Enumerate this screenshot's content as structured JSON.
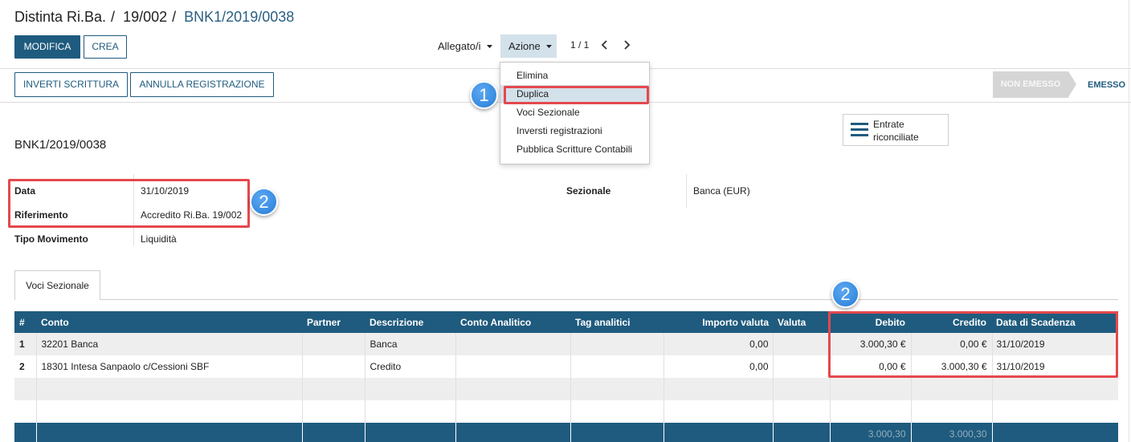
{
  "colors": {
    "primary": "#1f5b7e",
    "link": "#2a5f82",
    "highlight_red": "#e5484d",
    "badge_blue": "#3b8fe4",
    "row_alt": "#eeeeee",
    "menu_hover": "#d3e1ea",
    "status_inactive": "#d5d5d5"
  },
  "breadcrumb": {
    "items": [
      "Distinta Ri.Ba.",
      "19/002",
      "BNK1/2019/0038"
    ],
    "separator": "/"
  },
  "buttons": {
    "edit": "MODIFICA",
    "create": "CREA"
  },
  "toolbar": {
    "attachments": "Allegato/i",
    "action": "Azione",
    "pager": "1 / 1"
  },
  "action_menu": {
    "items": [
      "Elimina",
      "Duplica",
      "Voci Sezionale",
      "Inversti registrazioni",
      "Pubblica Scritture Contabili"
    ],
    "highlighted_index": 1
  },
  "header_buttons": {
    "reverse": "INVERTI SCRITTURA",
    "cancel": "ANNULLA REGISTRAZIONE"
  },
  "statusbar": {
    "stages": [
      "NON EMESSO",
      "EMESSO"
    ],
    "current_index": 1
  },
  "record": {
    "name": "BNK1/2019/0038"
  },
  "smart_button": {
    "label": "Entrate riconciliate",
    "icon": "list-icon"
  },
  "fields": {
    "left": [
      {
        "label": "Data",
        "value": "31/10/2019"
      },
      {
        "label": "Riferimento",
        "value": "Accredito Ri.Ba. 19/002"
      },
      {
        "label": "Tipo Movimento",
        "value": "Liquidità"
      }
    ],
    "right": [
      {
        "label": "Sezionale",
        "value": "Banca (EUR)"
      }
    ]
  },
  "tabs": [
    {
      "label": "Voci Sezionale",
      "active": true
    }
  ],
  "table": {
    "columns": [
      "#",
      "Conto",
      "Partner",
      "Descrizione",
      "Conto Analitico",
      "Tag analitici",
      "Importo valuta",
      "Valuta",
      "Debito",
      "Credito",
      "Data di Scadenza"
    ],
    "rows": [
      [
        "1",
        "32201 Banca",
        "",
        "Banca",
        "",
        "",
        "0,00",
        "",
        "3.000,30 €",
        "0,00 €",
        "31/10/2019"
      ],
      [
        "2",
        "18301 Intesa Sanpaolo c/Cessioni SBF",
        "",
        "Credito",
        "",
        "",
        "0,00",
        "",
        "0,00 €",
        "3.000,30 €",
        "31/10/2019"
      ]
    ],
    "totals": {
      "debit": "3.000,30",
      "credit": "3.000,30"
    }
  },
  "annotations": {
    "badges": [
      "1",
      "2",
      "2"
    ]
  }
}
